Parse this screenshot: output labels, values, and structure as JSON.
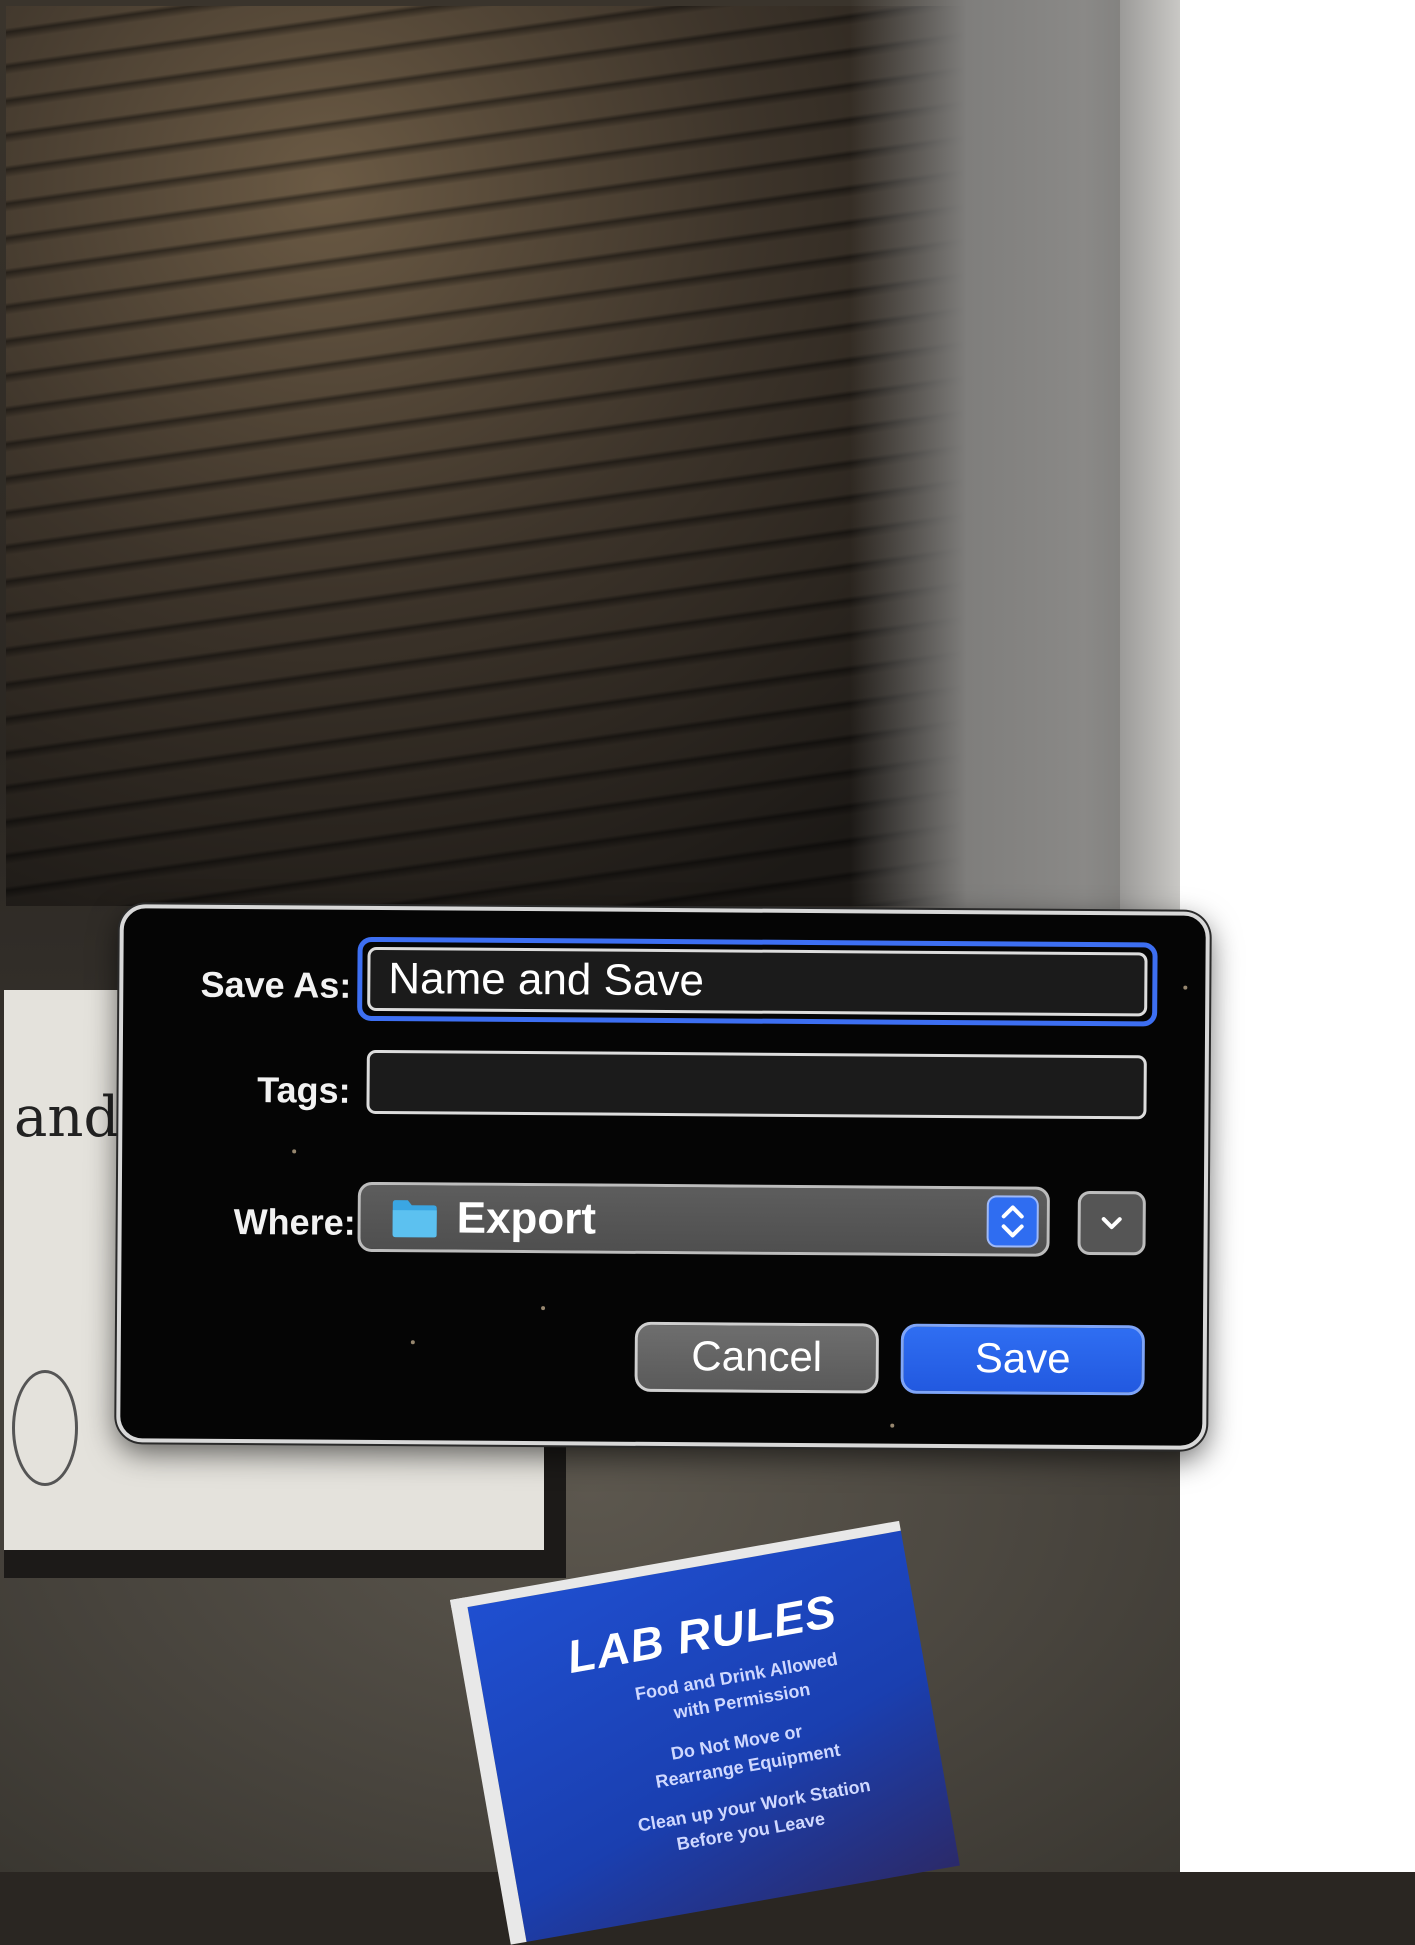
{
  "dialog": {
    "save_as_label": "Save As:",
    "save_as_value": "Name and Save",
    "tags_label": "Tags:",
    "tags_value": "",
    "where_label": "Where:",
    "where_value": "Export",
    "cancel_label": "Cancel",
    "save_label": "Save"
  },
  "background": {
    "certificate_fragment": "ando",
    "poster_title": "LAB RULES",
    "poster_lines": [
      "Food and Drink Allowed",
      "with Permission",
      "Do Not Move or",
      "Rearrange Equipment",
      "Clean up your Work Station",
      "Before you Leave"
    ]
  },
  "colors": {
    "accent": "#2f6ef2",
    "dialog_bg": "#050505",
    "folder": "#49b3ea"
  }
}
